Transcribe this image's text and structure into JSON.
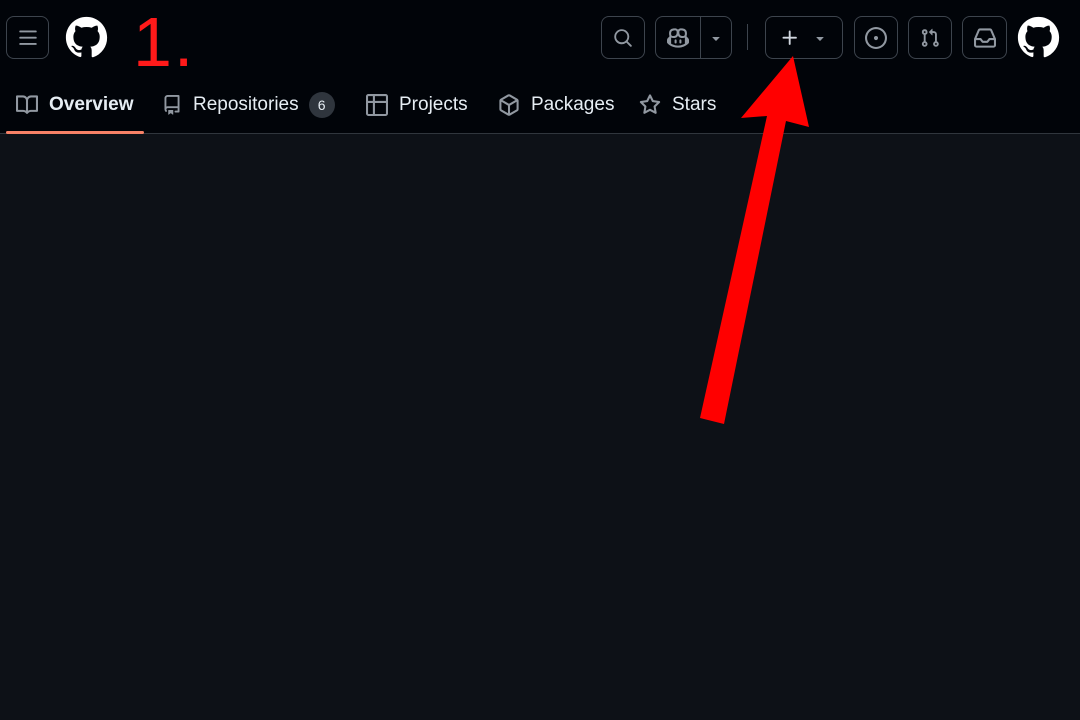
{
  "header": {
    "menu_icon": "hamburger-menu-icon",
    "logo_icon": "github-logo-icon",
    "step_label": "1.",
    "buttons": {
      "search": "search-icon",
      "copilot": "copilot-icon",
      "copilot_dropdown": "triangle-down-icon",
      "create": "plus-icon",
      "create_dropdown": "triangle-down-icon",
      "issues": "issue-opened-icon",
      "pull_requests": "git-pull-request-icon",
      "inbox": "inbox-icon"
    },
    "avatar_icon": "github-avatar-icon"
  },
  "tabs": [
    {
      "label": "Overview",
      "icon": "book-icon",
      "active": true
    },
    {
      "label": "Repositories",
      "icon": "repo-icon",
      "count": "6"
    },
    {
      "label": "Projects",
      "icon": "table-icon"
    },
    {
      "label": "Packages",
      "icon": "package-icon"
    },
    {
      "label": "Stars",
      "icon": "star-icon"
    }
  ],
  "annotation": {
    "arrow_color": "#ff0000",
    "label_color": "#ff1a1a",
    "points_to": "create-new-button"
  },
  "colors": {
    "background": "#0d1117",
    "header_background": "#010409",
    "border": "#3d444d",
    "active_tab_underline": "#f78166",
    "text": "#e6edf3",
    "icon": "#9198a1"
  }
}
